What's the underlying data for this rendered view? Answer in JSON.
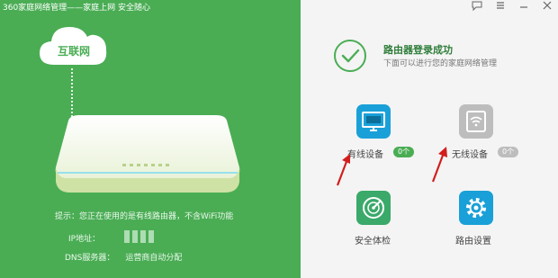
{
  "app": {
    "title": "360家庭网络管理——家庭上网 安全随心"
  },
  "window_controls": {
    "feedback_icon": "feedback-icon",
    "menu_icon": "menu-icon",
    "minimize_icon": "minimize-icon",
    "close_icon": "close-icon"
  },
  "cloud": {
    "label": "互联网"
  },
  "info": {
    "hint": "提示：您正在使用的是有线路由器，不含WiFi功能",
    "ip_label": "IP地址：",
    "dns_label": "DNS服务器：",
    "dns_value": "运营商自动分配"
  },
  "status": {
    "title": "路由器登录成功",
    "subtitle": "下面可以进行您的家庭网络管理"
  },
  "features": {
    "wired_label": "有线设备",
    "wired_count": "0个",
    "wireless_label": "无线设备",
    "wireless_count": "0个",
    "check_label": "安全体检",
    "settings_label": "路由设置"
  },
  "colors": {
    "accent_green": "#4aad54",
    "accent_blue": "#1aa0d8",
    "annotation_red": "#d21d1d"
  }
}
